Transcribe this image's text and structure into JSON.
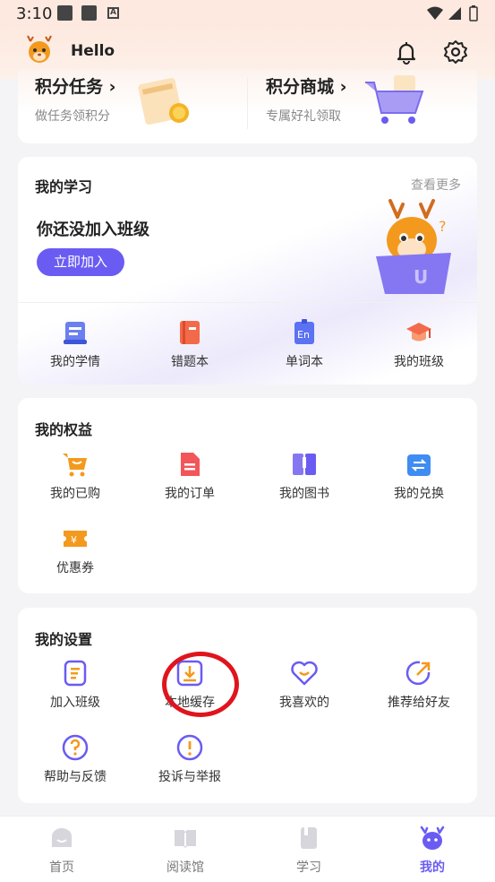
{
  "status_bar": {
    "time": "3:10"
  },
  "header": {
    "title": "Hello"
  },
  "points": {
    "tasks": {
      "title": "积分任务",
      "subtitle": "做任务领积分"
    },
    "mall": {
      "title": "积分商城",
      "subtitle": "专属好礼领取"
    }
  },
  "study": {
    "title": "我的学习",
    "more": "查看更多",
    "empty_text": "你还没加入班级",
    "join_button": "立即加入",
    "items": [
      {
        "label": "我的学情",
        "icon": "learning-report-icon"
      },
      {
        "label": "错题本",
        "icon": "mistake-book-icon"
      },
      {
        "label": "单词本",
        "icon": "vocabulary-book-icon"
      },
      {
        "label": "我的班级",
        "icon": "graduation-cap-icon"
      }
    ]
  },
  "rights": {
    "title": "我的权益",
    "items": [
      {
        "label": "我的已购",
        "icon": "shopping-cart-icon"
      },
      {
        "label": "我的订单",
        "icon": "order-icon"
      },
      {
        "label": "我的图书",
        "icon": "book-icon"
      },
      {
        "label": "我的兑换",
        "icon": "exchange-icon"
      },
      {
        "label": "优惠券",
        "icon": "coupon-icon"
      }
    ]
  },
  "settings": {
    "title": "我的设置",
    "items": [
      {
        "label": "加入班级",
        "icon": "join-class-icon"
      },
      {
        "label": "本地缓存",
        "icon": "download-icon"
      },
      {
        "label": "我喜欢的",
        "icon": "heart-icon"
      },
      {
        "label": "推荐给好友",
        "icon": "share-icon"
      },
      {
        "label": "帮助与反馈",
        "icon": "help-icon"
      },
      {
        "label": "投诉与举报",
        "icon": "report-icon"
      }
    ]
  },
  "tabs": [
    {
      "label": "首页",
      "icon": "home-icon"
    },
    {
      "label": "阅读馆",
      "icon": "reading-icon"
    },
    {
      "label": "学习",
      "icon": "study-icon"
    },
    {
      "label": "我的",
      "icon": "mine-icon",
      "active": true
    }
  ],
  "colors": {
    "accent": "#6a5cf2",
    "orange": "#f39a1e",
    "annotation": "#e0141d"
  }
}
